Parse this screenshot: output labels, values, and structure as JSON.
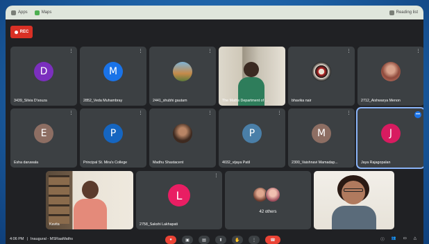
{
  "browser": {
    "tab_apps": "Apps",
    "tab_maps": "Maps",
    "reading_list": "Reading list"
  },
  "recording": {
    "label": "REC"
  },
  "participants": [
    {
      "name": "3439_Silvia D'souza",
      "initial": "D",
      "color": "#7b2fbe"
    },
    {
      "name": "2852_Veda Muhambray",
      "initial": "M",
      "color": "#1a73e8"
    },
    {
      "name": "2441_shubhi gautam",
      "initial": "",
      "color": "#c58a4a"
    },
    {
      "name": "The Maths Department of ...",
      "initial": "",
      "color": ""
    },
    {
      "name": "bhavika nair",
      "initial": "",
      "color": "#222"
    },
    {
      "name": "2712_Aishwarya Menon",
      "initial": "",
      "color": "#c77a6a"
    },
    {
      "name": "Esha daruwala",
      "initial": "E",
      "color": "#8d6e63"
    },
    {
      "name": "Principal St. Mira's College",
      "initial": "P",
      "color": "#1565c0"
    },
    {
      "name": "Madhu Shastacent",
      "initial": "",
      "color": "#6d4c41"
    },
    {
      "name": "4032_vijaya Patil",
      "initial": "P",
      "color": "#4a7fa8"
    },
    {
      "name": "2300_Vaishnavi Mamadap...",
      "initial": "M",
      "color": "#8d6e63"
    },
    {
      "name": "Jaya Rajagopalan",
      "initial": "J",
      "color": "#d81b60"
    },
    {
      "name": "Kavita",
      "initial": "",
      "color": ""
    },
    {
      "name": "2758_Sakshi Lakhapati",
      "initial": "L",
      "color": "#e91e63"
    },
    {
      "name": "42 others",
      "initial": "",
      "color": ""
    },
    {
      "name": "",
      "initial": "",
      "color": ""
    }
  ],
  "bottom": {
    "time": "4:06 PM",
    "meeting": "Inaugural - MSRaaMaths"
  },
  "icons": {
    "mic": "mic-icon",
    "pin": "pin-icon",
    "recording_dot": "record-dot-icon"
  }
}
